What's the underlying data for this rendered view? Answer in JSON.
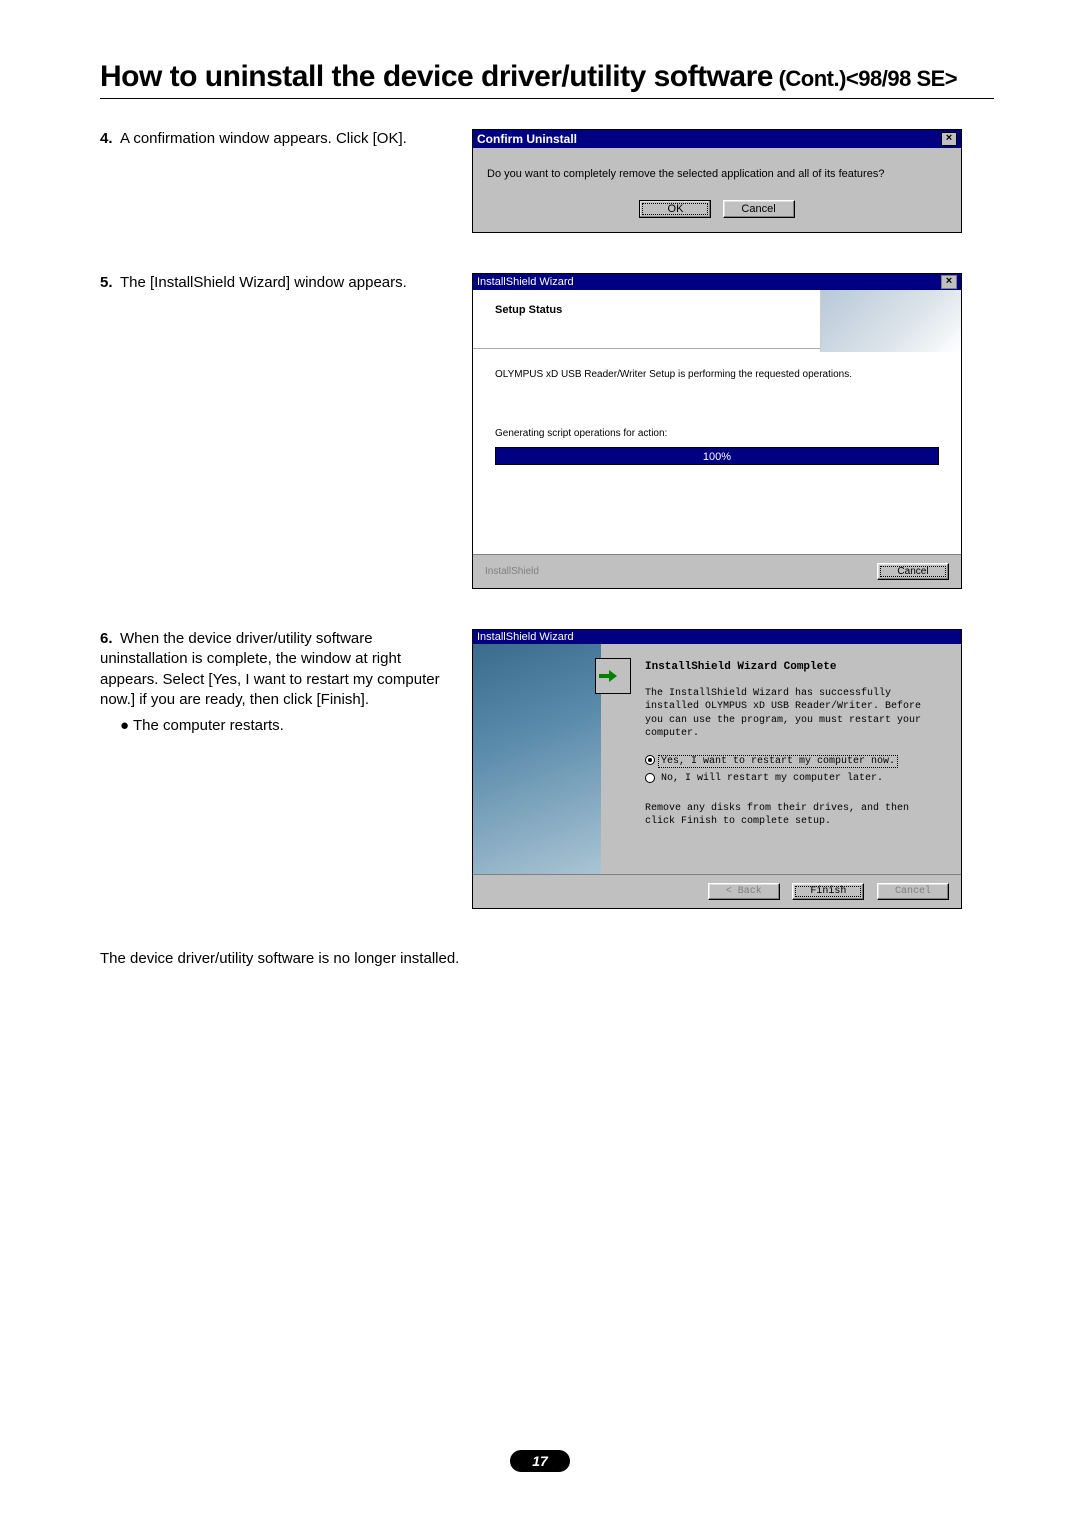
{
  "page_number": "17",
  "title": {
    "main": "How to uninstall the device driver/utility software",
    "sub": " (Cont.)<98/98 SE>"
  },
  "steps": {
    "s4": {
      "num": "4.",
      "text": "A confirmation window appears. Click [OK]."
    },
    "s5": {
      "num": "5.",
      "text": "The [InstallShield Wizard] window appears."
    },
    "s6": {
      "num": "6.",
      "text": "When the device driver/utility software uninstallation is complete, the window at right appears. Select [Yes, I want to restart my computer now.] if you are ready, then click [Finish].",
      "bullet": "● The computer restarts."
    },
    "closing": "The device driver/utility software is no longer installed."
  },
  "dlg1": {
    "title": "Confirm Uninstall",
    "close": "×",
    "message": "Do you want to completely remove the selected application and all of its features?",
    "ok": "OK",
    "cancel": "Cancel"
  },
  "dlg2": {
    "title": "InstallShield Wizard",
    "close": "×",
    "header": "Setup Status",
    "line1": "OLYMPUS xD USB Reader/Writer Setup is performing the requested operations.",
    "line2": "Generating script operations for action:",
    "progress_text": "100%",
    "brand": "InstallShield",
    "cancel": "Cancel"
  },
  "dlg3": {
    "title": "InstallShield Wizard",
    "heading": "InstallShield Wizard Complete",
    "para": "The InstallShield Wizard has successfully installed OLYMPUS xD USB Reader/Writer.  Before you can use the program, you must restart your computer.",
    "radio_yes": "Yes, I want to restart my computer now.",
    "radio_no": "No, I will restart my computer later.",
    "note": "Remove any disks from their drives, and then click Finish to complete setup.",
    "back": "< Back",
    "finish": "Finish",
    "cancel": "Cancel"
  }
}
